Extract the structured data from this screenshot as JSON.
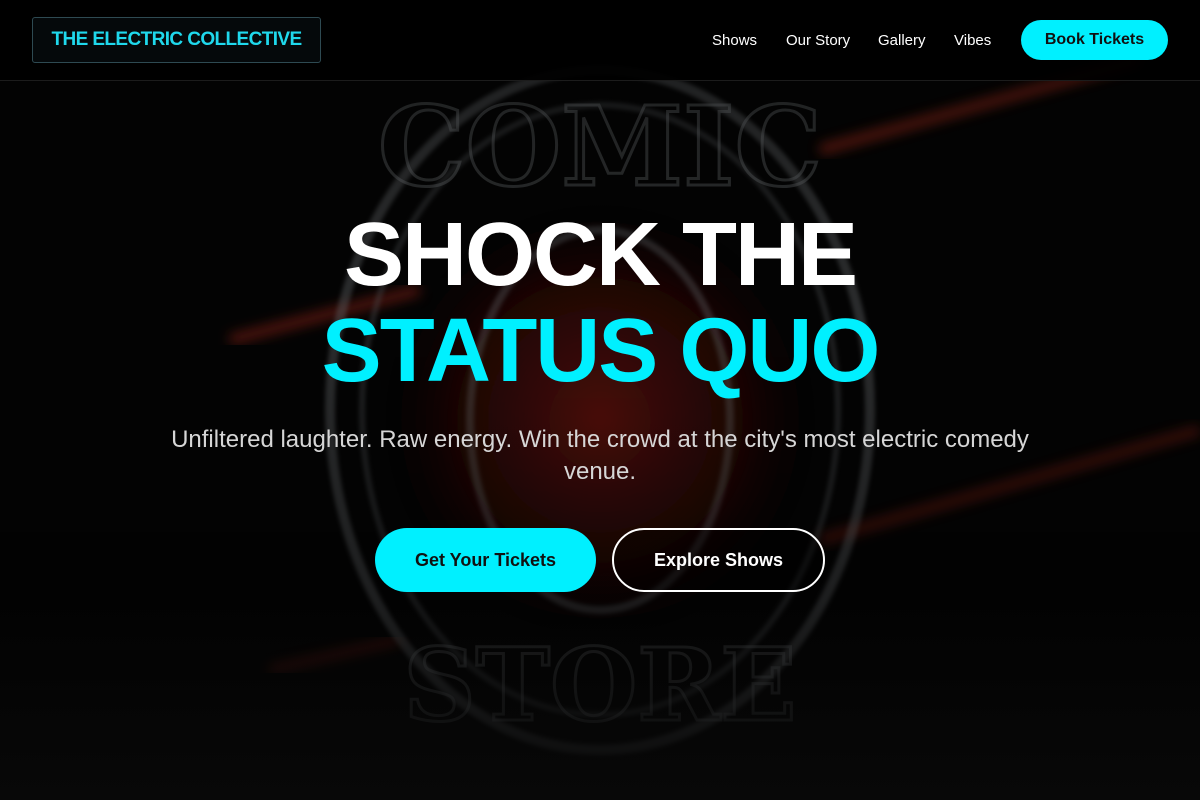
{
  "header": {
    "logo_text": "THE ELECTRIC COLLECTIVE",
    "nav": {
      "shows": "Shows",
      "our_story": "Our Story",
      "gallery": "Gallery",
      "vibes": "Vibes"
    },
    "cta_label": "Book Tickets"
  },
  "hero": {
    "title_line1": "SHOCK THE",
    "title_line2": "STATUS QUO",
    "subtitle": "Unfiltered laughter. Raw energy. Win the crowd at the city's most electric comedy venue.",
    "primary_button": "Get Your Tickets",
    "secondary_button": "Explore Shows",
    "background_image": "neon-comedy-store-sign"
  },
  "colors": {
    "accent": "#00f0ff",
    "background": "#000000",
    "text": "#ffffff"
  }
}
